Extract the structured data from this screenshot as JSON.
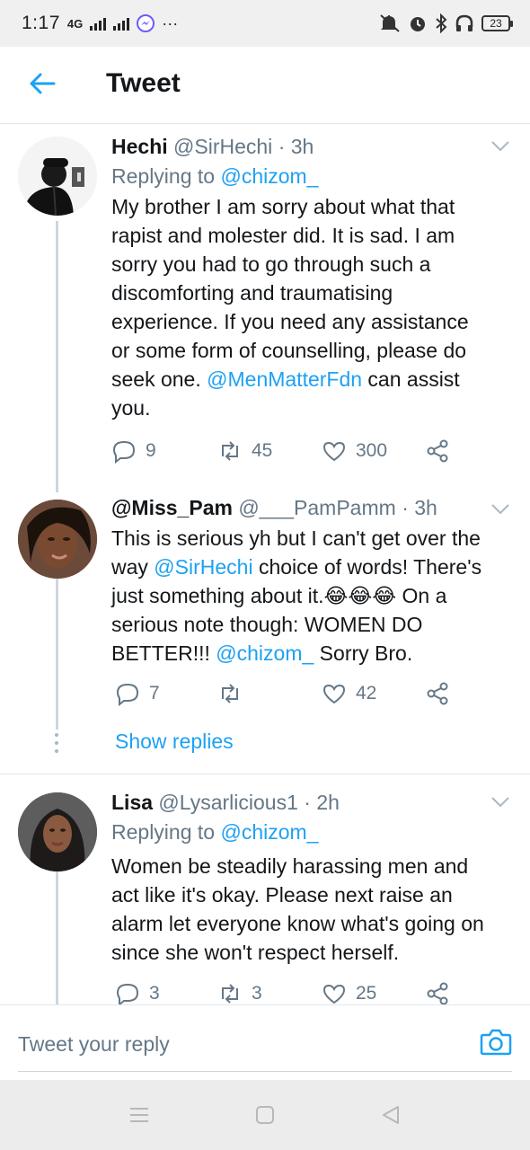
{
  "status_bar": {
    "time": "1:17",
    "signal_label": "4G",
    "battery": "23",
    "icons": [
      "messenger-icon",
      "more-dots-icon",
      "mute-icon",
      "alarm-icon",
      "bluetooth-icon",
      "headphones-icon",
      "battery-icon"
    ]
  },
  "header": {
    "title": "Tweet",
    "back_icon": "arrow-left-icon",
    "accent": "#1da1f2"
  },
  "tweets": [
    {
      "display_name": "Hechi",
      "handle": "@SirHechi",
      "time": "3h",
      "replying_prefix": "Replying to",
      "replying_to": "@chizom_",
      "text_1": "My brother I am sorry about what that",
      "text_2": "rapist and molester did. It is sad. I am",
      "text_3": "sorry you had to go through such a",
      "text_4": "discomforting and traumatising",
      "text_5": "experience. If you need any assistance",
      "text_6": "or some form of counselling, please do",
      "text_7a": "seek one. ",
      "text_7_mention": "@MenMatterFdn",
      "text_7b": " can assist",
      "text_8": "you.",
      "replies": "9",
      "retweets": "45",
      "likes": "300"
    },
    {
      "display_name": "@Miss_Pam",
      "handle": "@___PamPamm",
      "time": "3h",
      "text_1": "This is serious yh but I can't get over the",
      "text_2a": "way ",
      "text_2_mention": "@SirHechi",
      "text_2b": " choice of words! There's",
      "text_3a": "just something about it.",
      "text_3_emoji": "😂😂😂",
      "text_3b": " On a",
      "text_4": "serious note though: WOMEN DO",
      "text_5a": "BETTER!!! ",
      "text_5_mention": "@chizom_",
      "text_5b": " Sorry Bro.",
      "replies": "7",
      "retweets": "",
      "likes": "42",
      "show_replies": "Show replies"
    },
    {
      "display_name": "Lisa",
      "handle": "@Lysarlicious1",
      "time": "2h",
      "replying_prefix": "Replying to",
      "replying_to": "@chizom_",
      "text_1": "Women be steadily harassing men and",
      "text_2": "act like it's okay. Please next raise an",
      "text_3": "alarm let everyone know what's going on",
      "text_4": "since she won't respect herself.",
      "replies": "3",
      "retweets": "3",
      "likes": "25"
    }
  ],
  "reply_bar": {
    "placeholder": "Tweet your reply",
    "camera_icon": "camera-icon"
  },
  "nav_bar": {
    "icons": [
      "menu-icon",
      "home-square-icon",
      "back-triangle-icon"
    ]
  }
}
